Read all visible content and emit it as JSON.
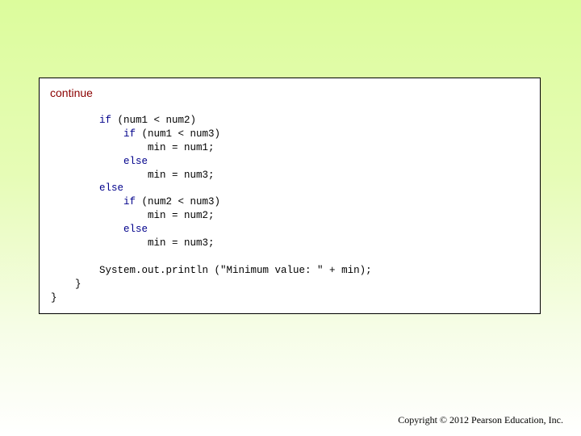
{
  "slide": {
    "heading": "continue",
    "copyright": "Copyright © 2012 Pearson Education, Inc."
  },
  "code_lines": [
    {
      "indent": "        ",
      "keyword": "if",
      "rest": " (num1 < num2)"
    },
    {
      "indent": "            ",
      "keyword": "if",
      "rest": " (num1 < num3)"
    },
    {
      "indent": "                ",
      "keyword": "",
      "rest": "min = num1;"
    },
    {
      "indent": "            ",
      "keyword": "else",
      "rest": ""
    },
    {
      "indent": "                ",
      "keyword": "",
      "rest": "min = num3;"
    },
    {
      "indent": "        ",
      "keyword": "else",
      "rest": ""
    },
    {
      "indent": "            ",
      "keyword": "if",
      "rest": " (num2 < num3)"
    },
    {
      "indent": "                ",
      "keyword": "",
      "rest": "min = num2;"
    },
    {
      "indent": "            ",
      "keyword": "else",
      "rest": ""
    },
    {
      "indent": "                ",
      "keyword": "",
      "rest": "min = num3;"
    },
    {
      "indent": "",
      "keyword": "",
      "rest": ""
    },
    {
      "indent": "        ",
      "keyword": "",
      "rest": "System.out.println (\"Minimum value: \" + min);"
    },
    {
      "indent": "    ",
      "keyword": "",
      "rest": "}"
    },
    {
      "indent": "",
      "keyword": "",
      "rest": "}"
    }
  ],
  "colors": {
    "heading": "#8b0000",
    "keyword": "#00008b",
    "code": "#000000"
  }
}
